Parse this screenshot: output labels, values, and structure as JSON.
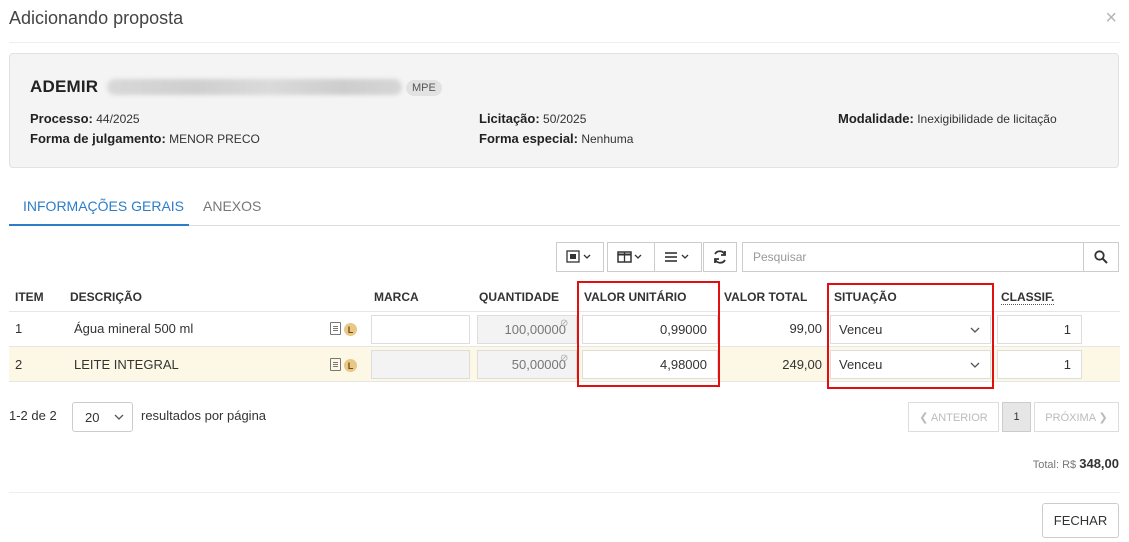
{
  "modal": {
    "title": "Adicionando proposta",
    "close": "×"
  },
  "supplier": {
    "name": "ADEMIR",
    "badge": "MPE"
  },
  "fields": {
    "processo": {
      "label": "Processo:",
      "value": "44/2025"
    },
    "licitacao": {
      "label": "Licitação:",
      "value": "50/2025"
    },
    "modalidade": {
      "label": "Modalidade:",
      "value": "Inexigibilidade de licitação"
    },
    "forma_julgamento": {
      "label": "Forma de julgamento:",
      "value": "MENOR PRECO"
    },
    "forma_especial": {
      "label": "Forma especial:",
      "value": "Nenhuma"
    }
  },
  "tabs": [
    {
      "label": "INFORMAÇÕES GERAIS",
      "active": true
    },
    {
      "label": "ANEXOS",
      "active": false
    }
  ],
  "search": {
    "placeholder": "Pesquisar"
  },
  "table": {
    "headers": {
      "item": "ITEM",
      "descricao": "DESCRIÇÃO",
      "marca": "MARCA",
      "quantidade": "QUANTIDADE",
      "valor_unitario": "VALOR UNITÁRIO",
      "valor_total": "VALOR TOTAL",
      "situacao": "SITUAÇÃO",
      "classif": "CLASSIF."
    },
    "rows": [
      {
        "item": "1",
        "descricao": "Água mineral 500 ml",
        "marca": "",
        "quantidade": "100,00000",
        "valor_unitario": "0,99000",
        "valor_total": "99,00",
        "situacao": "Venceu",
        "classif": "1",
        "badge": "L"
      },
      {
        "item": "2",
        "descricao": "LEITE INTEGRAL",
        "marca": "",
        "quantidade": "50,00000",
        "valor_unitario": "4,98000",
        "valor_total": "249,00",
        "situacao": "Venceu",
        "classif": "1",
        "badge": "L"
      }
    ]
  },
  "pagination": {
    "range": "1-2 de 2",
    "page_size": "20",
    "per_page_label": "resultados por página",
    "prev": "❮ ANTERIOR",
    "current": "1",
    "next": "PRÓXIMA ❯"
  },
  "total": {
    "label": "Total: R$",
    "value": "348,00"
  },
  "footer": {
    "close_label": "FECHAR"
  },
  "colors": {
    "accent": "#2d7dc9",
    "highlight": "#e01010",
    "row_highlight": "#fdf8e6"
  }
}
